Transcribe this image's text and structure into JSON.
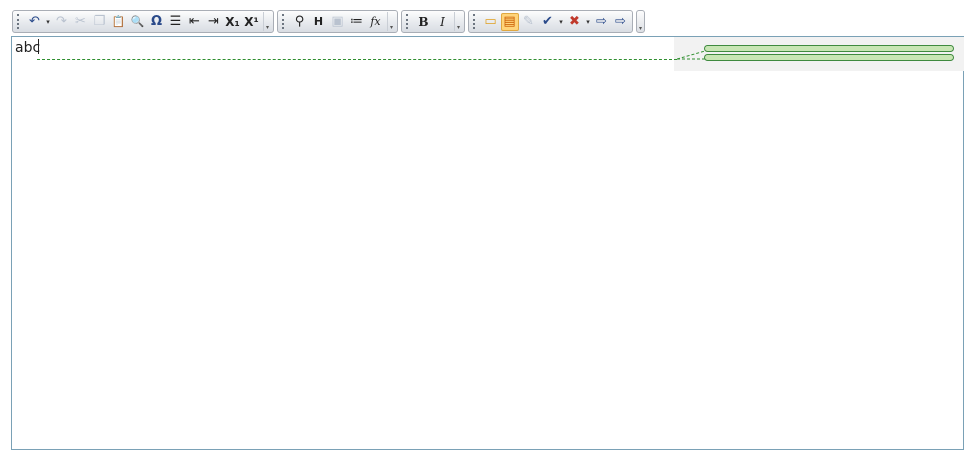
{
  "toolbar": {
    "group1": {
      "buttons": [
        {
          "name": "undo-icon",
          "glyph": "↶"
        },
        {
          "name": "undo-dropdown-icon",
          "glyph": "▾"
        },
        {
          "name": "redo-icon",
          "glyph": "↷",
          "disabled": true
        },
        {
          "name": "cut-icon",
          "glyph": "✂",
          "disabled": true
        },
        {
          "name": "copy-icon",
          "glyph": "❐",
          "disabled": true
        },
        {
          "name": "paste-icon",
          "glyph": "📋"
        },
        {
          "name": "find-icon",
          "glyph": "🔍"
        },
        {
          "name": "special-char-icon",
          "glyph": "Ω"
        },
        {
          "name": "bullet-list-icon",
          "glyph": "☰"
        },
        {
          "name": "outdent-icon",
          "glyph": "⇤"
        },
        {
          "name": "indent-icon",
          "glyph": "⇥"
        },
        {
          "name": "subscript-icon",
          "glyph": "X₁"
        },
        {
          "name": "superscript-icon",
          "glyph": "X¹"
        }
      ]
    },
    "group2": {
      "buttons": [
        {
          "name": "link-icon",
          "glyph": "⚲"
        },
        {
          "name": "heading-icon",
          "glyph": "H"
        },
        {
          "name": "image-icon",
          "glyph": "▣",
          "disabled": true
        },
        {
          "name": "numbered-list-icon",
          "glyph": "≔"
        },
        {
          "name": "formula-icon",
          "glyph": "fx"
        }
      ]
    },
    "group3": {
      "buttons": [
        {
          "name": "bold-icon",
          "glyph": "B"
        },
        {
          "name": "italic-icon",
          "glyph": "I"
        }
      ]
    },
    "group4": {
      "buttons": [
        {
          "name": "new-comment-icon",
          "glyph": "▭"
        },
        {
          "name": "show-comments-icon",
          "glyph": "▤",
          "selected": true
        },
        {
          "name": "edit-comment-icon",
          "glyph": "✎"
        },
        {
          "name": "accept-change-icon",
          "glyph": "✔"
        },
        {
          "name": "reject-change-icon",
          "glyph": "✖"
        },
        {
          "name": "previous-change-icon",
          "glyph": "⇨"
        },
        {
          "name": "next-change-icon",
          "glyph": "⇨"
        }
      ]
    }
  },
  "editor": {
    "text": "abc"
  }
}
